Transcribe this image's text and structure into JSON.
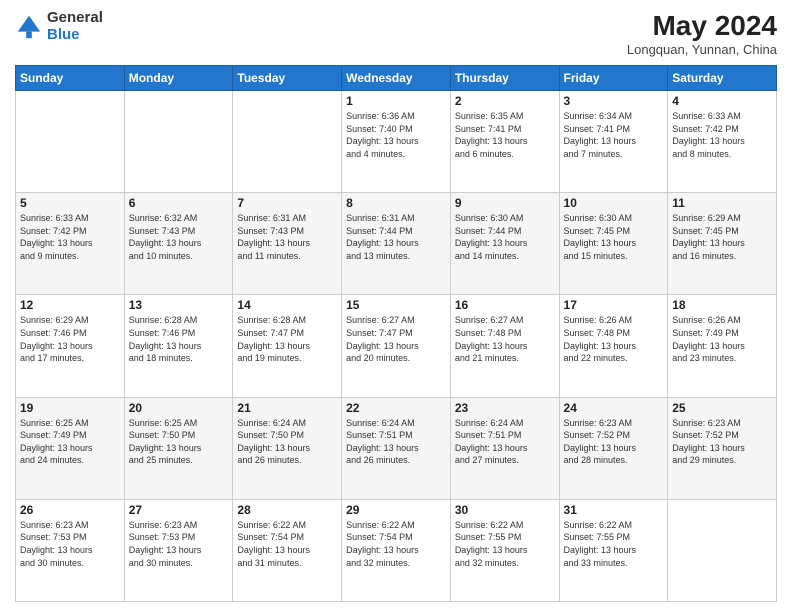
{
  "header": {
    "logo_general": "General",
    "logo_blue": "Blue",
    "month_year": "May 2024",
    "location": "Longquan, Yunnan, China"
  },
  "weekdays": [
    "Sunday",
    "Monday",
    "Tuesday",
    "Wednesday",
    "Thursday",
    "Friday",
    "Saturday"
  ],
  "weeks": [
    [
      {
        "day": "",
        "info": ""
      },
      {
        "day": "",
        "info": ""
      },
      {
        "day": "",
        "info": ""
      },
      {
        "day": "1",
        "info": "Sunrise: 6:36 AM\nSunset: 7:40 PM\nDaylight: 13 hours\nand 4 minutes."
      },
      {
        "day": "2",
        "info": "Sunrise: 6:35 AM\nSunset: 7:41 PM\nDaylight: 13 hours\nand 6 minutes."
      },
      {
        "day": "3",
        "info": "Sunrise: 6:34 AM\nSunset: 7:41 PM\nDaylight: 13 hours\nand 7 minutes."
      },
      {
        "day": "4",
        "info": "Sunrise: 6:33 AM\nSunset: 7:42 PM\nDaylight: 13 hours\nand 8 minutes."
      }
    ],
    [
      {
        "day": "5",
        "info": "Sunrise: 6:33 AM\nSunset: 7:42 PM\nDaylight: 13 hours\nand 9 minutes."
      },
      {
        "day": "6",
        "info": "Sunrise: 6:32 AM\nSunset: 7:43 PM\nDaylight: 13 hours\nand 10 minutes."
      },
      {
        "day": "7",
        "info": "Sunrise: 6:31 AM\nSunset: 7:43 PM\nDaylight: 13 hours\nand 11 minutes."
      },
      {
        "day": "8",
        "info": "Sunrise: 6:31 AM\nSunset: 7:44 PM\nDaylight: 13 hours\nand 13 minutes."
      },
      {
        "day": "9",
        "info": "Sunrise: 6:30 AM\nSunset: 7:44 PM\nDaylight: 13 hours\nand 14 minutes."
      },
      {
        "day": "10",
        "info": "Sunrise: 6:30 AM\nSunset: 7:45 PM\nDaylight: 13 hours\nand 15 minutes."
      },
      {
        "day": "11",
        "info": "Sunrise: 6:29 AM\nSunset: 7:45 PM\nDaylight: 13 hours\nand 16 minutes."
      }
    ],
    [
      {
        "day": "12",
        "info": "Sunrise: 6:29 AM\nSunset: 7:46 PM\nDaylight: 13 hours\nand 17 minutes."
      },
      {
        "day": "13",
        "info": "Sunrise: 6:28 AM\nSunset: 7:46 PM\nDaylight: 13 hours\nand 18 minutes."
      },
      {
        "day": "14",
        "info": "Sunrise: 6:28 AM\nSunset: 7:47 PM\nDaylight: 13 hours\nand 19 minutes."
      },
      {
        "day": "15",
        "info": "Sunrise: 6:27 AM\nSunset: 7:47 PM\nDaylight: 13 hours\nand 20 minutes."
      },
      {
        "day": "16",
        "info": "Sunrise: 6:27 AM\nSunset: 7:48 PM\nDaylight: 13 hours\nand 21 minutes."
      },
      {
        "day": "17",
        "info": "Sunrise: 6:26 AM\nSunset: 7:48 PM\nDaylight: 13 hours\nand 22 minutes."
      },
      {
        "day": "18",
        "info": "Sunrise: 6:26 AM\nSunset: 7:49 PM\nDaylight: 13 hours\nand 23 minutes."
      }
    ],
    [
      {
        "day": "19",
        "info": "Sunrise: 6:25 AM\nSunset: 7:49 PM\nDaylight: 13 hours\nand 24 minutes."
      },
      {
        "day": "20",
        "info": "Sunrise: 6:25 AM\nSunset: 7:50 PM\nDaylight: 13 hours\nand 25 minutes."
      },
      {
        "day": "21",
        "info": "Sunrise: 6:24 AM\nSunset: 7:50 PM\nDaylight: 13 hours\nand 26 minutes."
      },
      {
        "day": "22",
        "info": "Sunrise: 6:24 AM\nSunset: 7:51 PM\nDaylight: 13 hours\nand 26 minutes."
      },
      {
        "day": "23",
        "info": "Sunrise: 6:24 AM\nSunset: 7:51 PM\nDaylight: 13 hours\nand 27 minutes."
      },
      {
        "day": "24",
        "info": "Sunrise: 6:23 AM\nSunset: 7:52 PM\nDaylight: 13 hours\nand 28 minutes."
      },
      {
        "day": "25",
        "info": "Sunrise: 6:23 AM\nSunset: 7:52 PM\nDaylight: 13 hours\nand 29 minutes."
      }
    ],
    [
      {
        "day": "26",
        "info": "Sunrise: 6:23 AM\nSunset: 7:53 PM\nDaylight: 13 hours\nand 30 minutes."
      },
      {
        "day": "27",
        "info": "Sunrise: 6:23 AM\nSunset: 7:53 PM\nDaylight: 13 hours\nand 30 minutes."
      },
      {
        "day": "28",
        "info": "Sunrise: 6:22 AM\nSunset: 7:54 PM\nDaylight: 13 hours\nand 31 minutes."
      },
      {
        "day": "29",
        "info": "Sunrise: 6:22 AM\nSunset: 7:54 PM\nDaylight: 13 hours\nand 32 minutes."
      },
      {
        "day": "30",
        "info": "Sunrise: 6:22 AM\nSunset: 7:55 PM\nDaylight: 13 hours\nand 32 minutes."
      },
      {
        "day": "31",
        "info": "Sunrise: 6:22 AM\nSunset: 7:55 PM\nDaylight: 13 hours\nand 33 minutes."
      },
      {
        "day": "",
        "info": ""
      }
    ]
  ]
}
